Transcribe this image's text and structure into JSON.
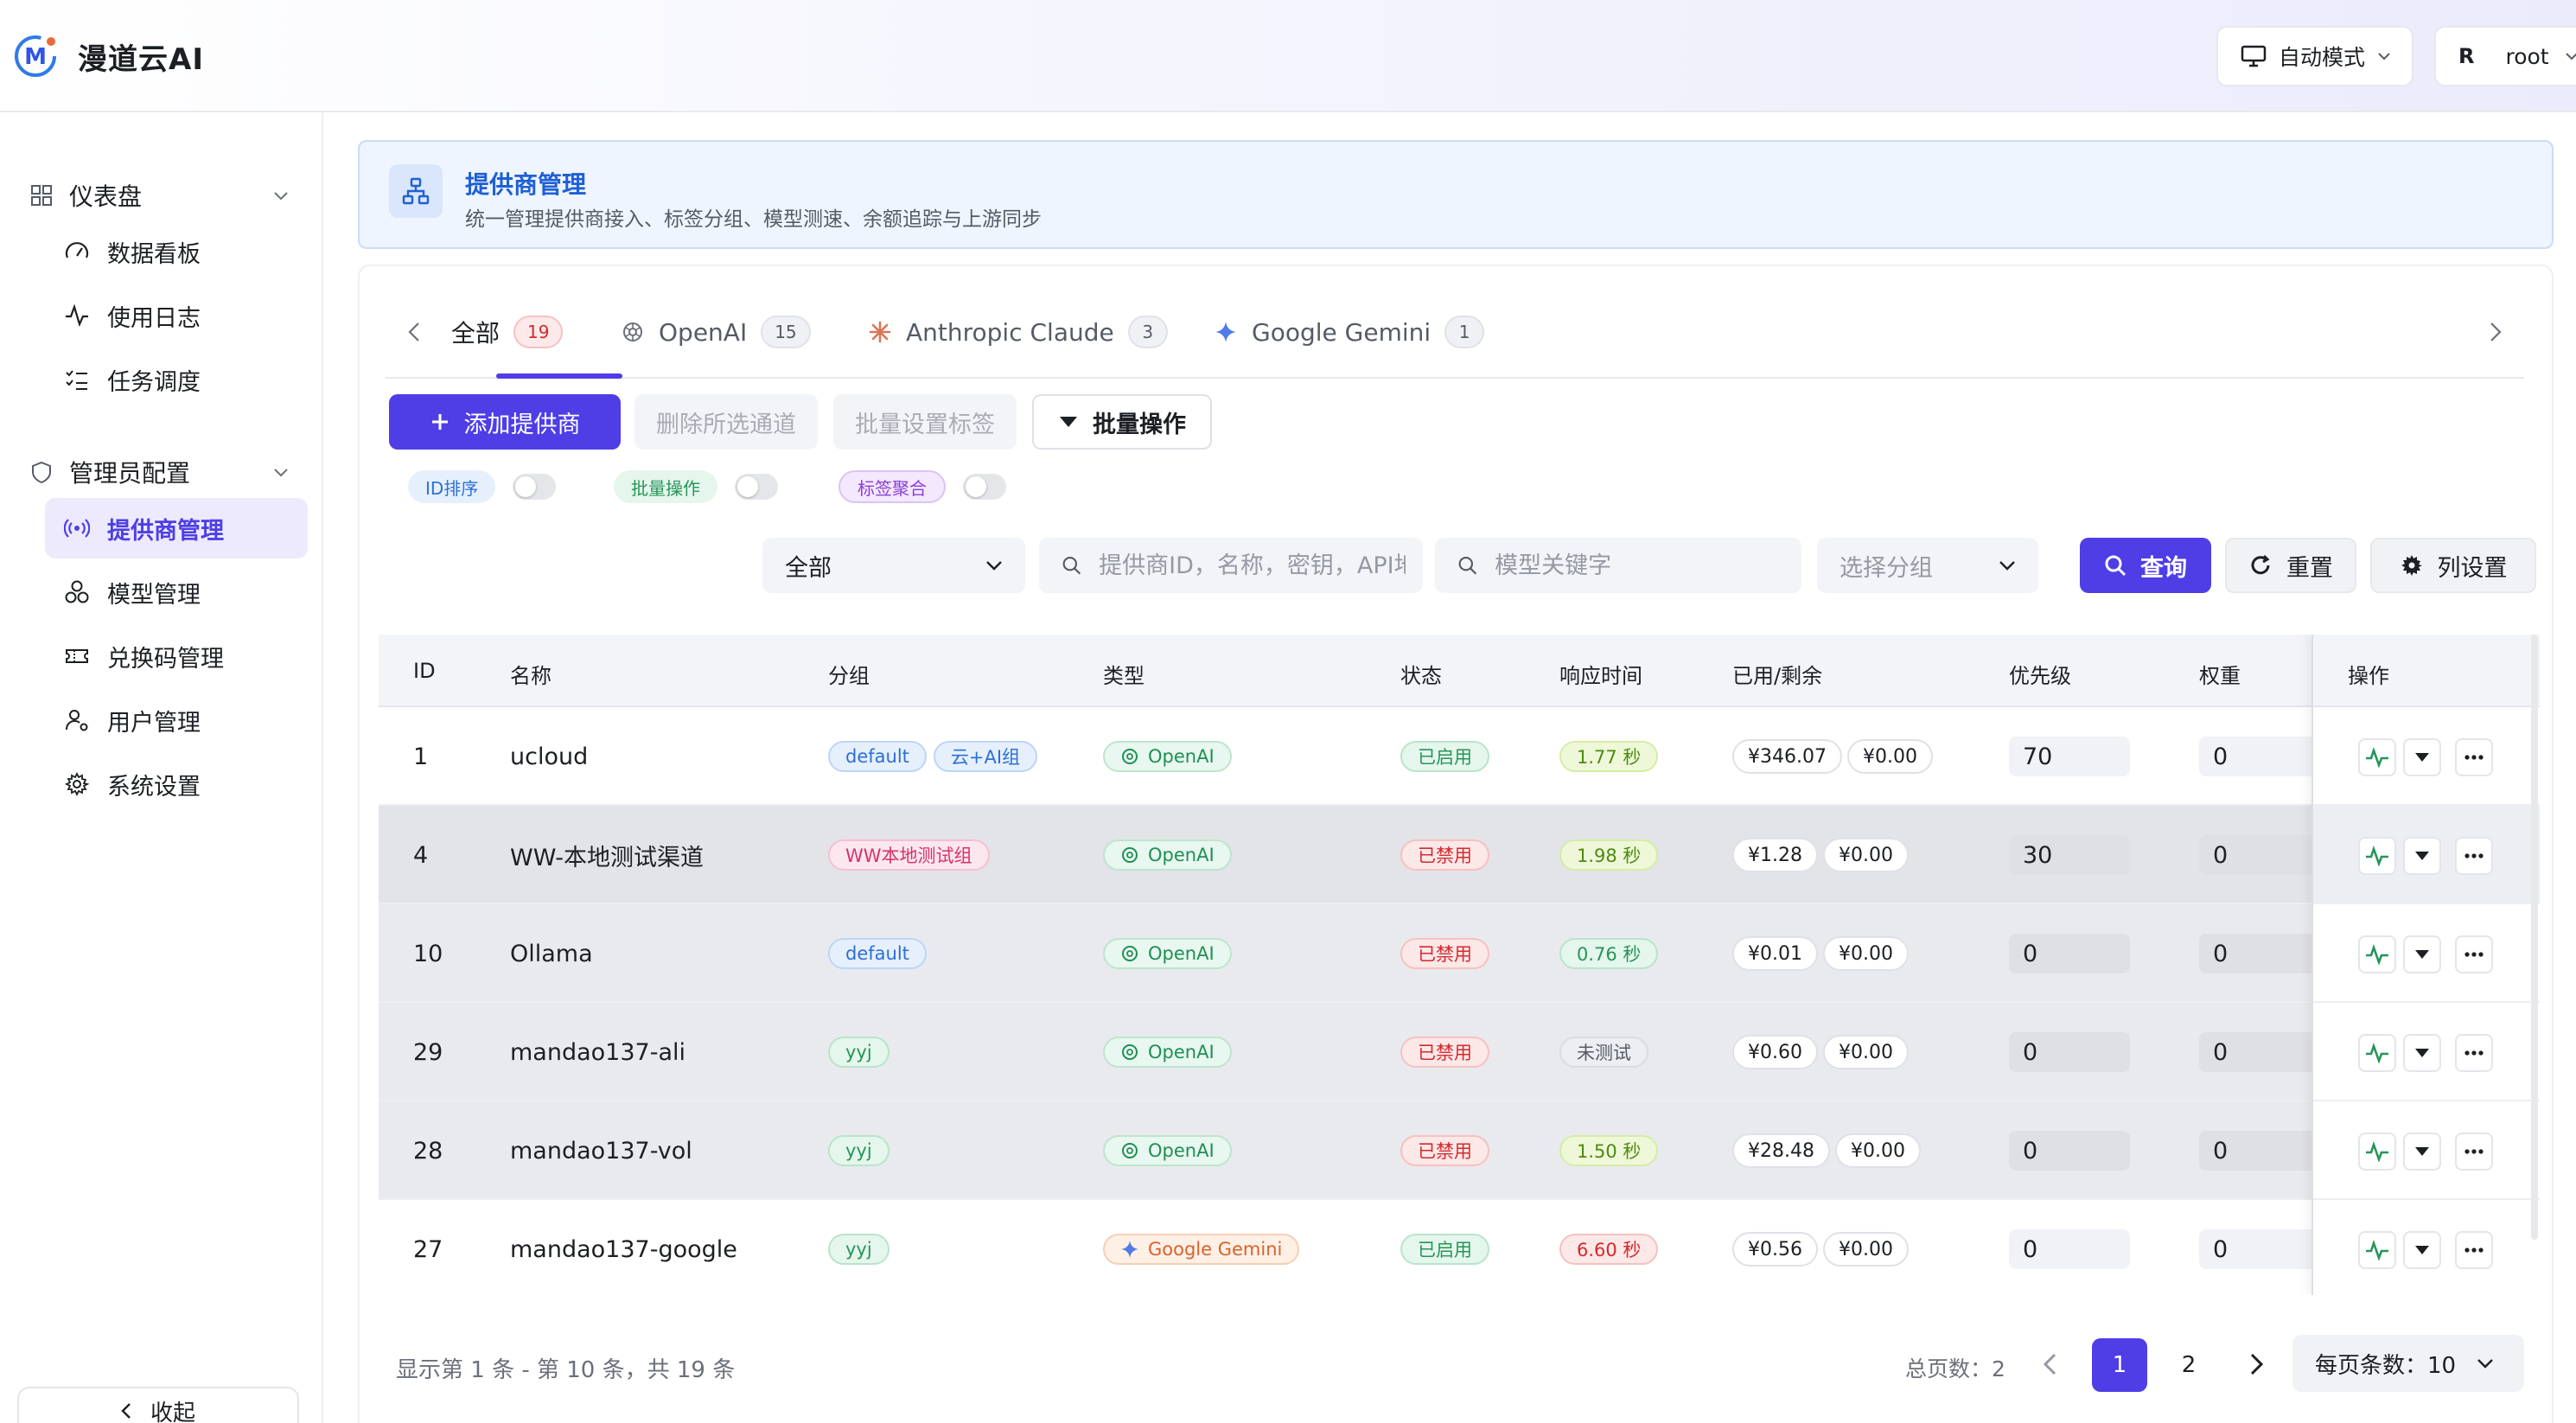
{
  "app": {
    "name": "漫道云AI",
    "logo_letter": "M"
  },
  "topbar": {
    "mode_label": "自动模式",
    "user_avatar": "R",
    "user_name": "root"
  },
  "sidebar": {
    "groups": [
      {
        "label": "仪表盘",
        "items": [
          {
            "label": "数据看板"
          },
          {
            "label": "使用日志"
          },
          {
            "label": "任务调度"
          }
        ]
      },
      {
        "label": "管理员配置",
        "items": [
          {
            "label": "提供商管理"
          },
          {
            "label": "模型管理"
          },
          {
            "label": "兑换码管理"
          },
          {
            "label": "用户管理"
          },
          {
            "label": "系统设置"
          }
        ]
      }
    ],
    "active_item": "提供商管理",
    "collapse_label": "收起"
  },
  "header": {
    "title": "提供商管理",
    "subtitle": "统一管理提供商接入、标签分组、模型测速、余额追踪与上游同步"
  },
  "tabs": [
    {
      "label": "全部",
      "count": "19"
    },
    {
      "label": "OpenAI",
      "count": "15"
    },
    {
      "label": "Anthropic Claude",
      "count": "3"
    },
    {
      "label": "Google Gemini",
      "count": "1"
    }
  ],
  "toolbar": {
    "add_label": "添加提供商",
    "delete_label": "删除所选通道",
    "batch_tag_label": "批量设置标签",
    "batch_ops_label": "批量操作"
  },
  "toggles": [
    {
      "label": "ID排序",
      "on": false
    },
    {
      "label": "批量操作",
      "on": false
    },
    {
      "label": "标签聚合",
      "on": false
    }
  ],
  "filters": {
    "type_value": "全部",
    "search_placeholder": "提供商ID，名称，密钥，API地址",
    "model_placeholder": "模型关键字",
    "group_placeholder": "选择分组",
    "query_label": "查询",
    "reset_label": "重置",
    "columns_label": "列设置"
  },
  "table": {
    "columns": [
      "ID",
      "名称",
      "分组",
      "类型",
      "状态",
      "响应时间",
      "已用/剩余",
      "优先级",
      "权重",
      "操作"
    ],
    "rows": [
      {
        "id": "1",
        "name": "ucloud",
        "groups": [
          "default",
          "云+AI组"
        ],
        "type": "OpenAI",
        "status": "已启用",
        "response": "1.77 秒",
        "used": "¥346.07",
        "remain": "¥0.00",
        "priority": "70",
        "weight": "0"
      },
      {
        "id": "4",
        "name": "WW-本地测试渠道",
        "groups": [
          "WW本地测试组"
        ],
        "type": "OpenAI",
        "status": "已禁用",
        "response": "1.98 秒",
        "used": "¥1.28",
        "remain": "¥0.00",
        "priority": "30",
        "weight": "0"
      },
      {
        "id": "10",
        "name": "Ollama",
        "groups": [
          "default"
        ],
        "type": "OpenAI",
        "status": "已禁用",
        "response": "0.76 秒",
        "used": "¥0.01",
        "remain": "¥0.00",
        "priority": "0",
        "weight": "0"
      },
      {
        "id": "29",
        "name": "mandao137-ali",
        "groups": [
          "yyj"
        ],
        "type": "OpenAI",
        "status": "已禁用",
        "response": "未测试",
        "used": "¥0.60",
        "remain": "¥0.00",
        "priority": "0",
        "weight": "0"
      },
      {
        "id": "28",
        "name": "mandao137-vol",
        "groups": [
          "yyj"
        ],
        "type": "OpenAI",
        "status": "已禁用",
        "response": "1.50 秒",
        "used": "¥28.48",
        "remain": "¥0.00",
        "priority": "0",
        "weight": "0"
      },
      {
        "id": "27",
        "name": "mandao137-google",
        "groups": [
          "yyj"
        ],
        "type": "Google Gemini",
        "status": "已启用",
        "response": "6.60 秒",
        "used": "¥0.56",
        "remain": "¥0.00",
        "priority": "0",
        "weight": "0"
      }
    ]
  },
  "footer": {
    "info": "显示第 1 条 - 第 10 条，共 19 条",
    "total_pages_label": "总页数：2",
    "pages": [
      "1",
      "2"
    ],
    "current_page": "1",
    "page_size_label": "每页条数：10"
  },
  "colors": {
    "accent": "#4f3ee6",
    "info_blue": "#1f5fd6",
    "danger": "#d5292c",
    "success": "#25955a"
  }
}
